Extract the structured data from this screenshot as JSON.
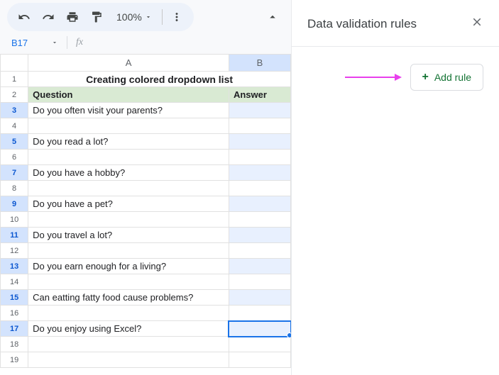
{
  "toolbar": {
    "zoom": "100%"
  },
  "namebox": {
    "ref": "B17",
    "fx": "fx"
  },
  "columns": {
    "A": "A",
    "B": "B"
  },
  "sheet": {
    "title": "Creating colored dropdown list",
    "header_a": "Question",
    "header_b": "Answer",
    "rows": [
      {
        "n": 1,
        "a": "",
        "b": "",
        "title": true
      },
      {
        "n": 2,
        "a": "",
        "b": "",
        "header": true
      },
      {
        "n": 3,
        "a": "Do you often visit your parents?",
        "b": "",
        "sel": true
      },
      {
        "n": 4,
        "a": "",
        "b": ""
      },
      {
        "n": 5,
        "a": "Do you read a lot?",
        "b": "",
        "sel": true
      },
      {
        "n": 6,
        "a": "",
        "b": ""
      },
      {
        "n": 7,
        "a": "Do you have a hobby?",
        "b": "",
        "sel": true
      },
      {
        "n": 8,
        "a": "",
        "b": ""
      },
      {
        "n": 9,
        "a": "Do you have a pet?",
        "b": "",
        "sel": true
      },
      {
        "n": 10,
        "a": "",
        "b": ""
      },
      {
        "n": 11,
        "a": "Do you travel a lot?",
        "b": "",
        "sel": true
      },
      {
        "n": 12,
        "a": "",
        "b": ""
      },
      {
        "n": 13,
        "a": "Do you earn enough for a  living?",
        "b": "",
        "sel": true
      },
      {
        "n": 14,
        "a": "",
        "b": ""
      },
      {
        "n": 15,
        "a": "Can eatting fatty food cause problems?",
        "b": "",
        "sel": true
      },
      {
        "n": 16,
        "a": "",
        "b": ""
      },
      {
        "n": 17,
        "a": "Do you enjoy using Excel?",
        "b": "",
        "sel": true,
        "active": true
      },
      {
        "n": 18,
        "a": "",
        "b": ""
      },
      {
        "n": 19,
        "a": "",
        "b": ""
      }
    ]
  },
  "panel": {
    "title": "Data validation rules",
    "add_rule": "Add rule"
  }
}
